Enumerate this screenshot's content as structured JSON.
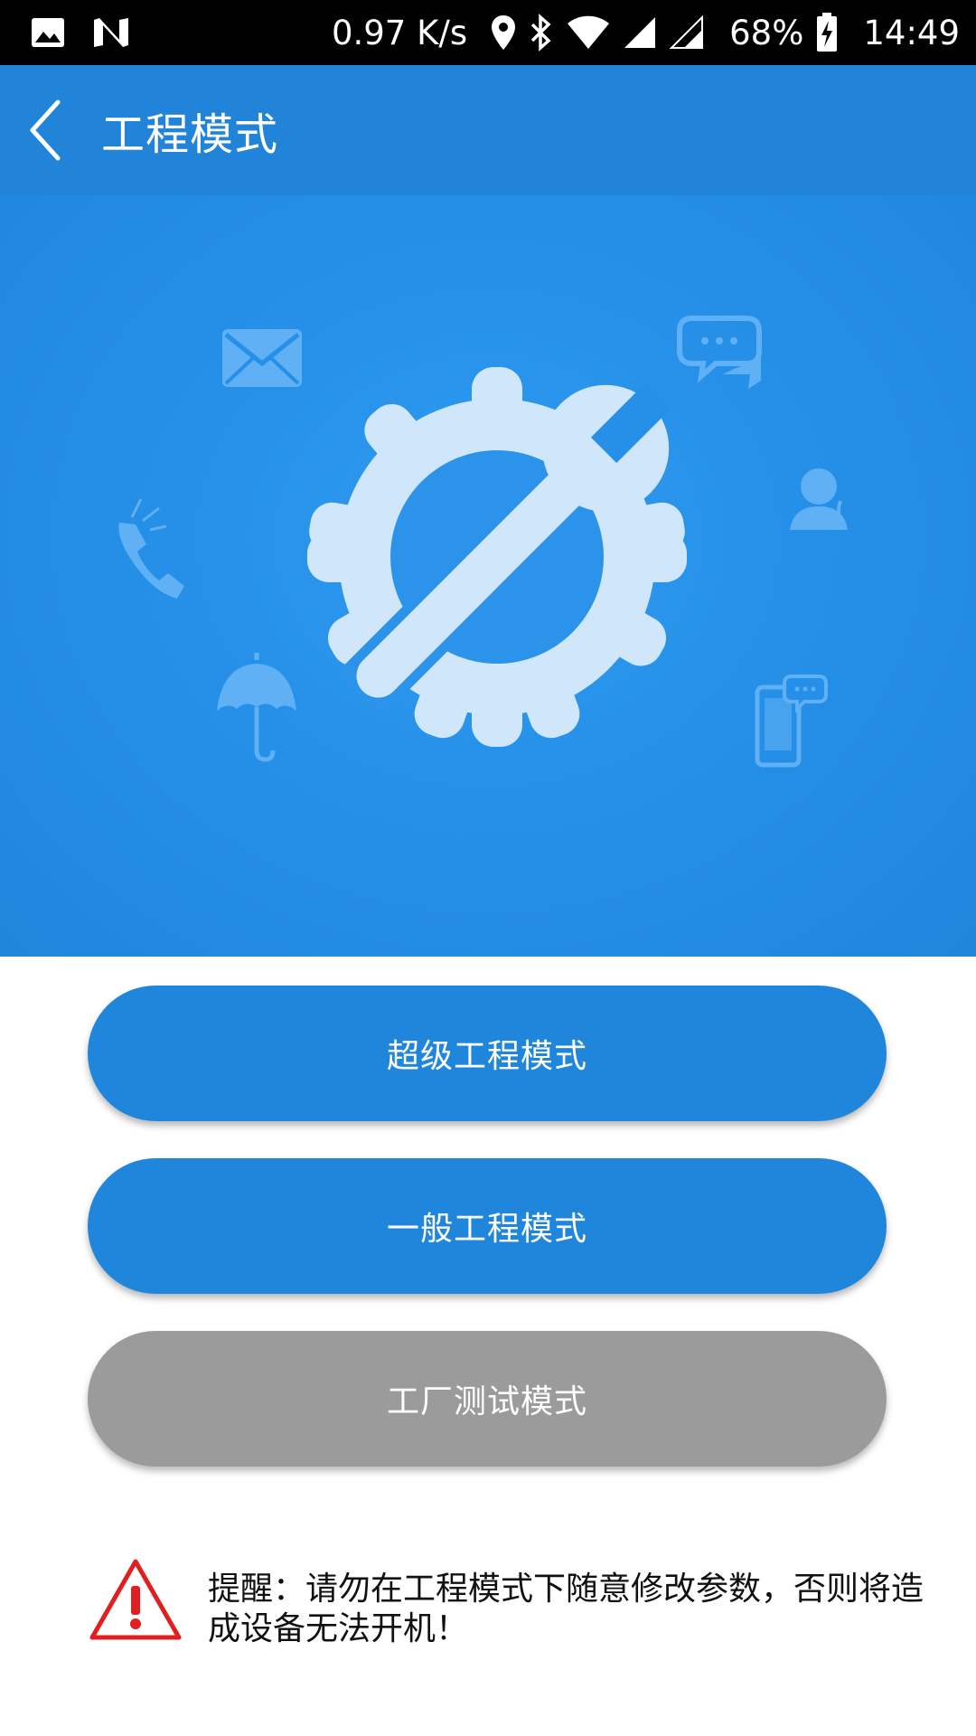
{
  "status_bar": {
    "network_speed": "0.97 K/s",
    "battery": "68%",
    "time": "14:49",
    "icons": [
      "image-icon",
      "n-icon",
      "location-icon",
      "bluetooth-icon",
      "wifi-icon",
      "signal-icon",
      "signal-icon-2",
      "battery-charging-icon"
    ]
  },
  "app_bar": {
    "title": "工程模式",
    "back_icon": "chevron-left-icon"
  },
  "hero": {
    "icons": [
      "wrench-gear-icon",
      "mail-icon",
      "chat-icon",
      "phone-icon",
      "contact-icon",
      "umbrella-icon",
      "phone-chat-icon"
    ]
  },
  "buttons": {
    "super_mode": "超级工程模式",
    "general_mode": "一般工程模式",
    "factory_test": "工厂测试模式"
  },
  "warning": {
    "icon": "warning-triangle-icon",
    "text": "提醒：请勿在工程模式下随意修改参数，否则将造成设备无法开机！"
  },
  "colors": {
    "primary": "#1f86dc",
    "disabled": "#9b9b9b",
    "warning": "#e02020"
  }
}
